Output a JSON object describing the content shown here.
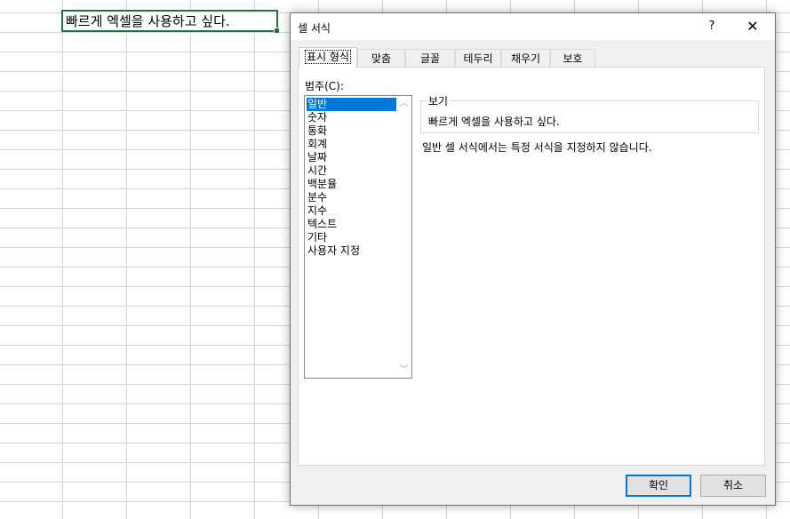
{
  "sheet": {
    "cell_text": "빠르게 엑셀을 사용하고 싶다."
  },
  "dialog": {
    "title": "셀 서식",
    "help_label": "?",
    "close_label": "✕",
    "tabs": [
      {
        "label": "표시 형식",
        "active": true
      },
      {
        "label": "맞춤"
      },
      {
        "label": "글꼴"
      },
      {
        "label": "테두리"
      },
      {
        "label": "채우기"
      },
      {
        "label": "보호"
      }
    ],
    "category_label": "범주(C):",
    "categories": [
      "일반",
      "숫자",
      "통화",
      "회계",
      "날짜",
      "시간",
      "백분율",
      "분수",
      "지수",
      "텍스트",
      "기타",
      "사용자 지정"
    ],
    "selected_category": "일반",
    "preview_label": "보기",
    "preview_value": "빠르게 엑셀을 사용하고 싶다.",
    "description": "일반 셀 서식에서는 특정 서식을 지정하지 않습니다.",
    "ok_label": "확인",
    "cancel_label": "취소"
  },
  "colors": {
    "active_cell_border": "#217346",
    "selection": "#0078d7",
    "ok_border": "#0078d7"
  },
  "icons": {
    "scroll_up": "chevron-up-icon",
    "scroll_down": "chevron-down-icon"
  }
}
